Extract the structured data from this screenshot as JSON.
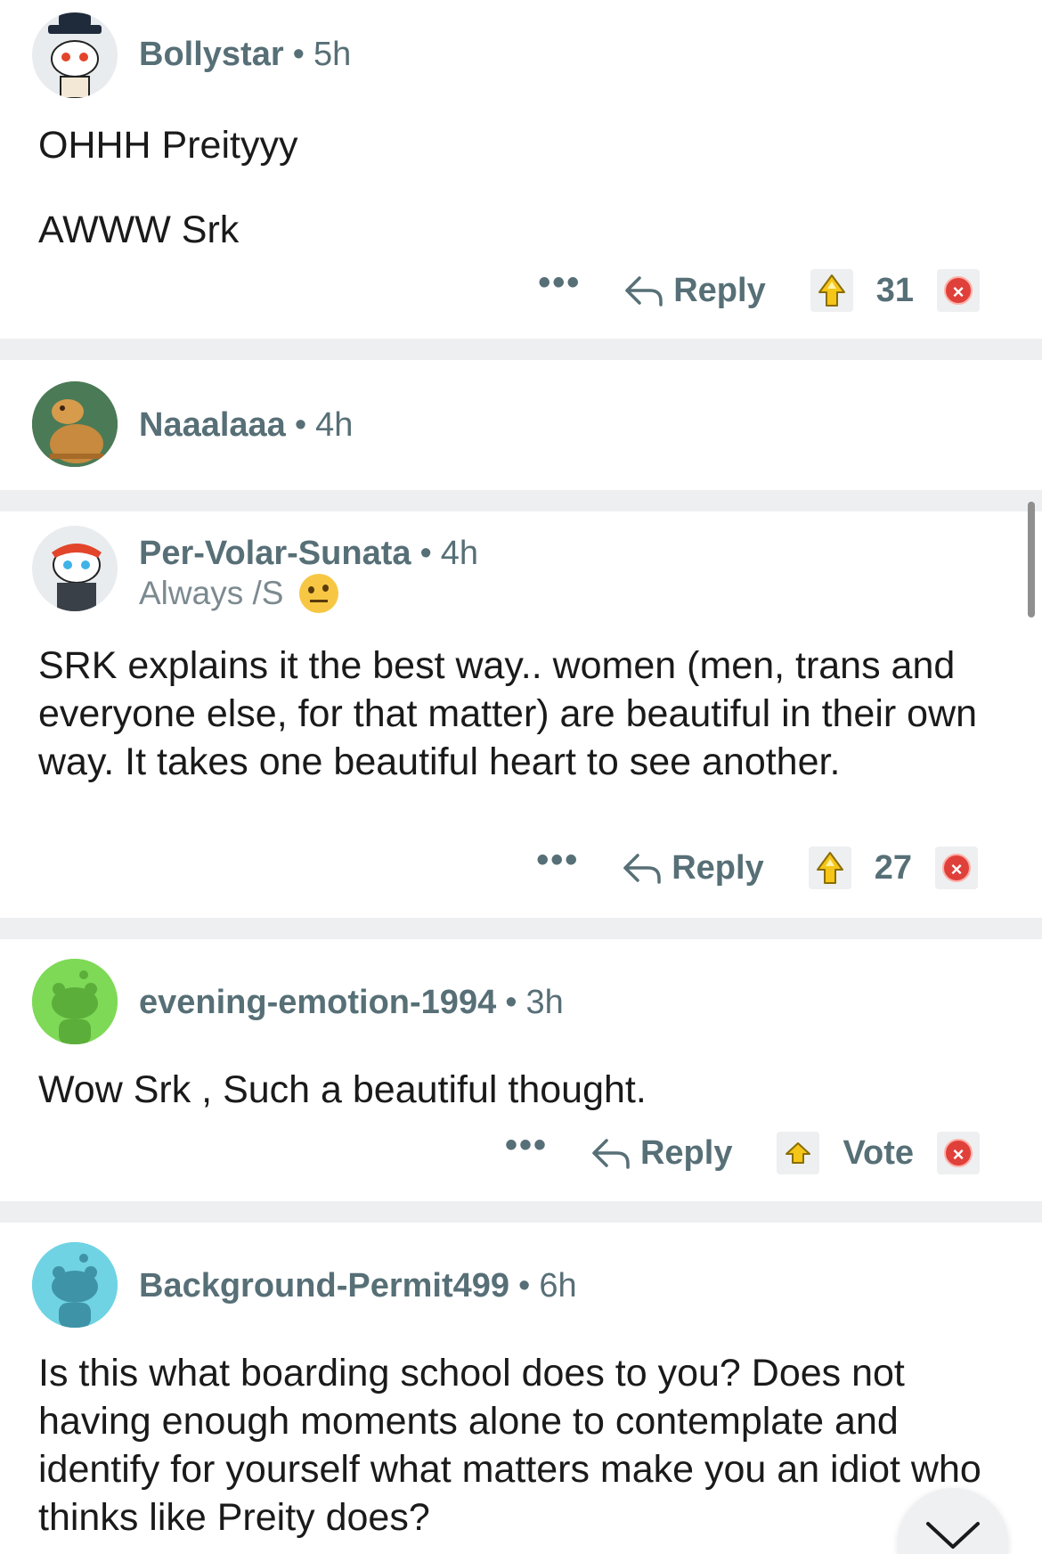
{
  "comments": [
    {
      "username": "Bollystar",
      "age": "5h",
      "flair": "",
      "body": [
        "OHHH Preityyy",
        "AWWW Srk"
      ],
      "more": "•••",
      "reply_label": "Reply",
      "score": "31",
      "avatar_color": "#e8ecef"
    },
    {
      "username": "Naaalaaa",
      "age": "4h",
      "flair": "",
      "body": [],
      "avatar_color": "#3d6b4a"
    },
    {
      "username": "Per-Volar-Sunata",
      "age": "4h",
      "flair": "Always /S",
      "body": [
        "SRK explains it the best way.. women (men, trans and everyone else, for that matter) are beautiful in their own way. It takes one beautiful heart to see another."
      ],
      "more": "•••",
      "reply_label": "Reply",
      "score": "27",
      "avatar_color": "#e8ecef"
    },
    {
      "username": "evening-emotion-1994",
      "age": "3h",
      "flair": "",
      "body": [
        "Wow Srk , Such a beautiful thought."
      ],
      "more": "•••",
      "reply_label": "Reply",
      "score": "Vote",
      "avatar_color": "#7ed957"
    },
    {
      "username": "Background-Permit499",
      "age": "6h",
      "flair": "",
      "body": [
        "Is this what boarding school does to you? Does not having enough moments alone to contemplate and identify for yourself what matters make you an idiot who thinks like Preity does?"
      ],
      "avatar_color": "#6fd3e3"
    }
  ],
  "separator_dot": "•",
  "icons": {
    "reply": "reply-arrow-icon",
    "upvote": "gold-upvote-icon",
    "downvote": "red-x-downvote-icon",
    "scroll_down": "chevron-down-icon"
  },
  "colors": {
    "meta_text": "#576f76",
    "separator": "#edeff1",
    "downvote": "#e0403a",
    "upvote": "#f5c518"
  }
}
